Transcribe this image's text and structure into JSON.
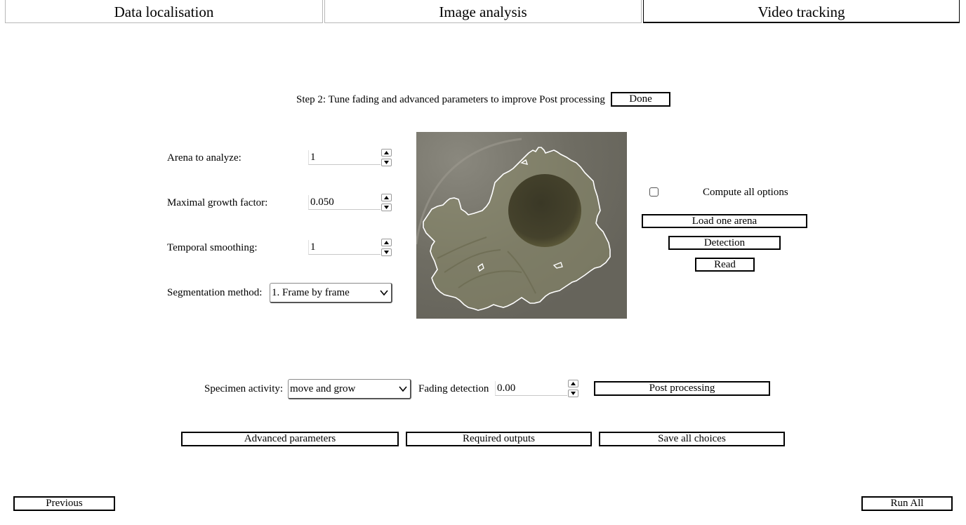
{
  "tabs": [
    {
      "label": "Data localisation"
    },
    {
      "label": "Image analysis"
    },
    {
      "label": "Video tracking"
    }
  ],
  "step": {
    "text": "Step 2: Tune fading and advanced parameters to improve Post processing",
    "done_label": "Done"
  },
  "params": {
    "arena": {
      "label": "Arena to analyze:",
      "value": "1"
    },
    "growth": {
      "label": "Maximal growth factor:",
      "value": "0.050"
    },
    "smoothing": {
      "label": "Temporal smoothing:",
      "value": "1"
    },
    "segmentation": {
      "label": "Segmentation method:",
      "value": "1. Frame by frame"
    }
  },
  "right_panel": {
    "compute_all_label": "Compute all options",
    "compute_all_checked": false,
    "load_arena_label": "Load one arena",
    "detection_label": "Detection",
    "read_label": "Read"
  },
  "activity": {
    "label": "Specimen activity:",
    "value": "move and grow",
    "fading_label": "Fading detection",
    "fading_value": "0.00",
    "post_processing_label": "Post processing"
  },
  "bottom_buttons": {
    "advanced": "Advanced parameters",
    "outputs": "Required outputs",
    "save": "Save all choices"
  },
  "nav": {
    "previous": "Previous",
    "run_all": "Run All"
  },
  "colors": {
    "preview_bg": "#6e6c63",
    "colony": "#3a3a2a",
    "contour": "#ffffff"
  }
}
